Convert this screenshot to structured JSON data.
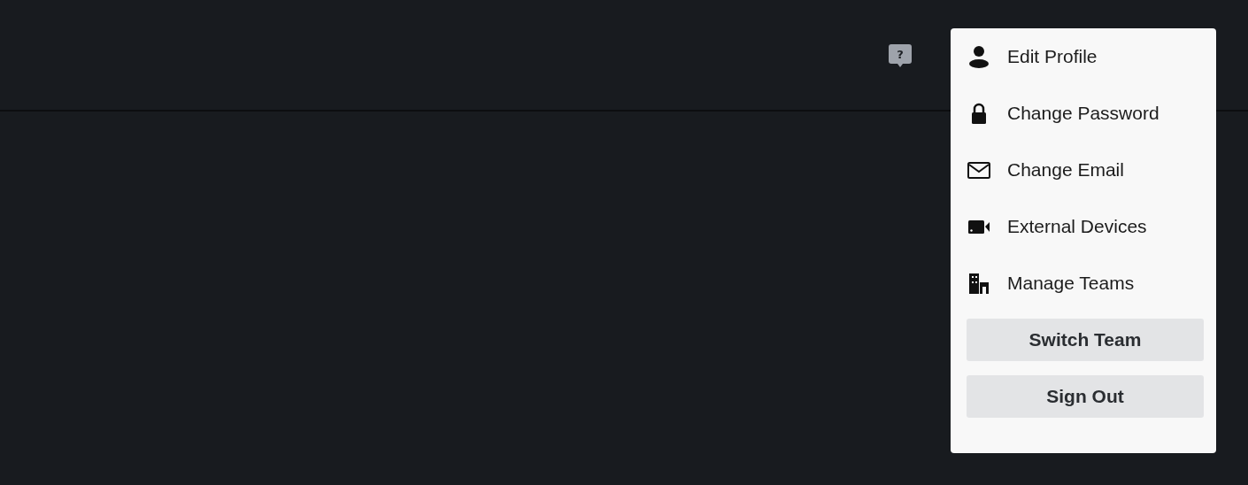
{
  "header": {
    "help_badge": "?"
  },
  "account_menu": {
    "items": [
      {
        "kind": "person",
        "label": "Edit Profile"
      },
      {
        "kind": "lock",
        "label": "Change Password"
      },
      {
        "kind": "envelope",
        "label": "Change Email"
      },
      {
        "kind": "camera",
        "label": "External Devices"
      },
      {
        "kind": "building",
        "label": "Manage Teams"
      }
    ],
    "buttons": [
      "Switch Team",
      "Sign Out"
    ]
  }
}
